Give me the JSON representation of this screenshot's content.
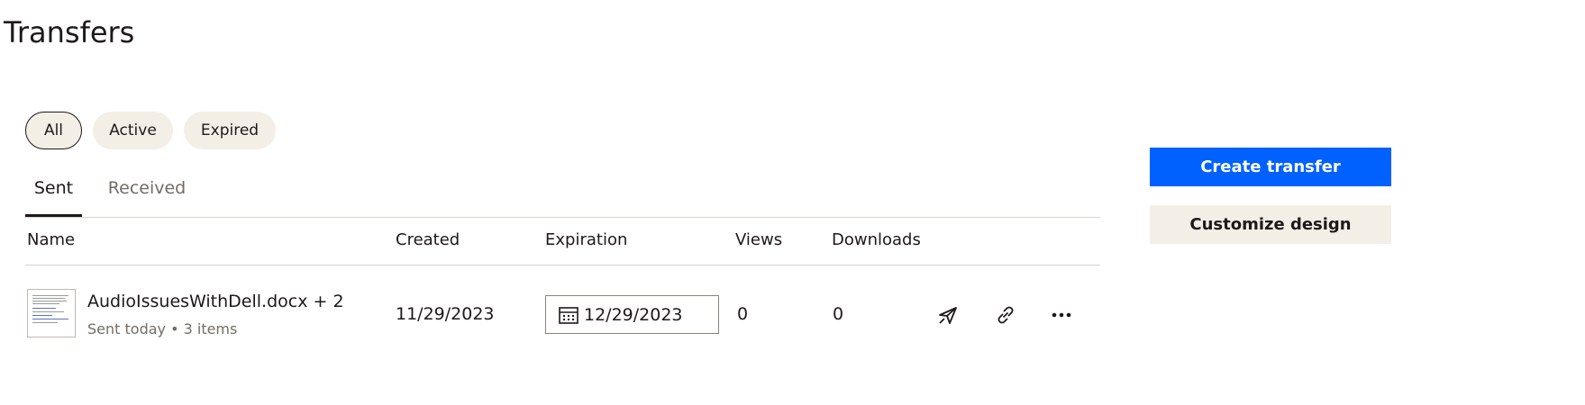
{
  "page": {
    "title": "Transfers"
  },
  "filters": {
    "all": "All",
    "active": "Active",
    "expired": "Expired",
    "selected": "All"
  },
  "tabs": {
    "sent": "Sent",
    "received": "Received",
    "selected": "Sent"
  },
  "table": {
    "headers": {
      "name": "Name",
      "created": "Created",
      "expiration": "Expiration",
      "views": "Views",
      "downloads": "Downloads"
    },
    "rows": [
      {
        "name": "AudioIssuesWithDell.docx + 2",
        "meta": "Sent today • 3 items",
        "created": "11/29/2023",
        "expiration": "12/29/2023",
        "views": "0",
        "downloads": "0",
        "icons": [
          "send-icon",
          "link-icon",
          "more-icon"
        ]
      }
    ]
  },
  "actions": {
    "create": "Create transfer",
    "customize": "Customize design"
  },
  "colors": {
    "primary": "#0061fe",
    "chip_bg": "#f4efe6",
    "text": "#1e1919",
    "muted": "#736c64"
  }
}
